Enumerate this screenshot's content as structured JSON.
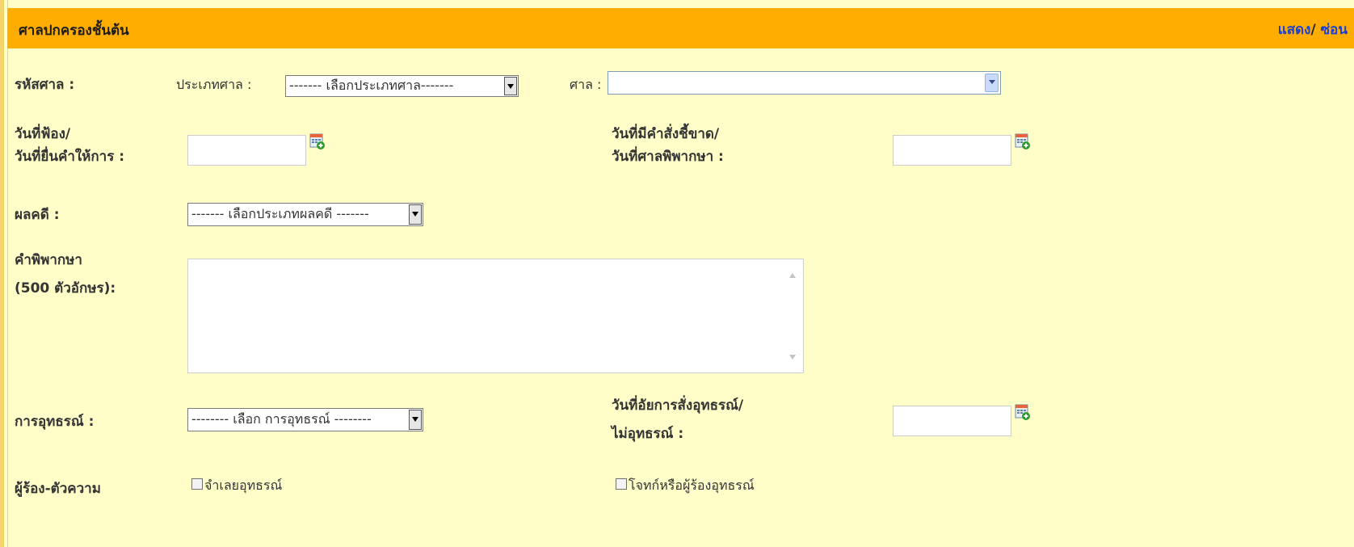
{
  "section": {
    "title": "ศาลปกครองชั้นต้น",
    "show_link": "แสดง",
    "separator": "/",
    "hide_link": "ซ่อน"
  },
  "court_code": {
    "label": "รหัสศาล :",
    "court_type_label": "ประเภทศาล :",
    "court_type_value": "------- เลือกประเภทศาล-------",
    "court_label": "ศาล :",
    "court_value": ""
  },
  "filing_date": {
    "label_line1": "วันที่ฟ้อง/",
    "label_line2": "วันที่ยื่นคำให้การ :",
    "value": ""
  },
  "judgment_date": {
    "label_line1": "วันที่มีคำสั่งชี้ขาด/",
    "label_line2": "วันที่ศาลพิพากษา :",
    "value": ""
  },
  "verdict": {
    "label": "ผลคดี :",
    "value": "------- เลือกประเภทผลคดี -------"
  },
  "judgment_text": {
    "label_line1": "คำพิพากษา",
    "label_line2": "(500 ตัวอักษร):",
    "value": ""
  },
  "appeal": {
    "label": "การอุทธรณ์ :",
    "value": "-------- เลือก การอุทธรณ์ --------"
  },
  "appeal_order_date": {
    "label_line1": "วันที่อัยการสั่งอุทธรณ์/",
    "label_line2": "ไม่อุทธรณ์ :",
    "value": ""
  },
  "parties": {
    "label": "ผู้ร้อง-ตัวความ",
    "defendant_appeal_label": "จำเลยอุทธรณ์",
    "plaintiff_appeal_label": "โจทก์หรือผู้ร้องอุทธรณ์"
  },
  "colors": {
    "header_bg": "#ffad00",
    "page_bg": "#fffdc8",
    "link": "#1a3fd1"
  }
}
